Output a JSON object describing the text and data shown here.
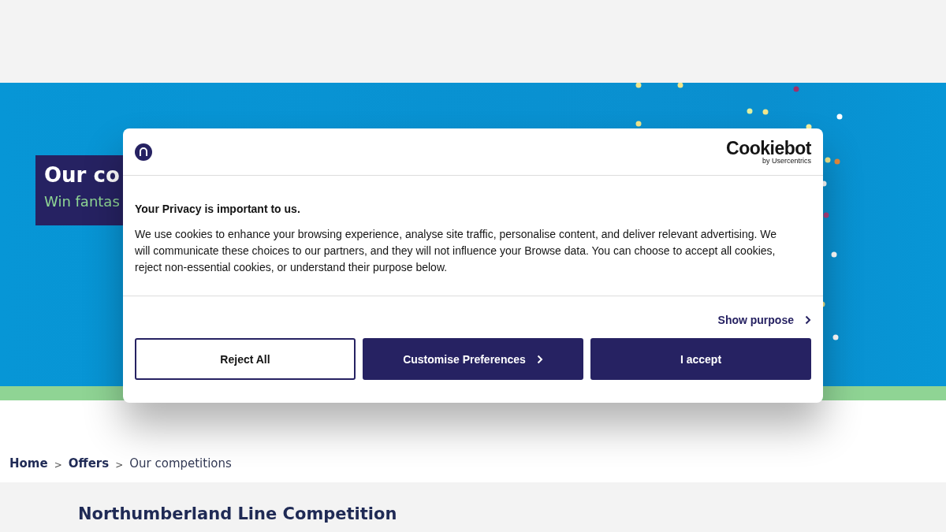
{
  "hero": {
    "title": "Our co",
    "subtitle": "Win fantas"
  },
  "breadcrumb": [
    {
      "label": "Home",
      "kind": "link"
    },
    {
      "label": "Offers",
      "kind": "link"
    },
    {
      "label": "Our competitions",
      "kind": "current"
    }
  ],
  "separator": ">",
  "section": {
    "heading": "Northumberland Line Competition"
  },
  "dialog": {
    "brand": {
      "name": "Cookiebot",
      "byline": "by Usercentrics"
    },
    "title": "Your Privacy is important to us.",
    "body": "We use cookies to enhance your browsing experience, analyse site traffic, personalise content, and deliver relevant advertising. We will communicate these choices to our partners, and they will not influence your Browse data. You can choose to accept all cookies, reject non-essential cookies, or understand their purpose below.",
    "show_purpose": "Show purpose",
    "buttons": [
      {
        "label": "Reject All",
        "kind": "outline"
      },
      {
        "label": "Customise Preferences",
        "kind": "chevron"
      },
      {
        "label": "I accept",
        "kind": "filled"
      }
    ]
  }
}
